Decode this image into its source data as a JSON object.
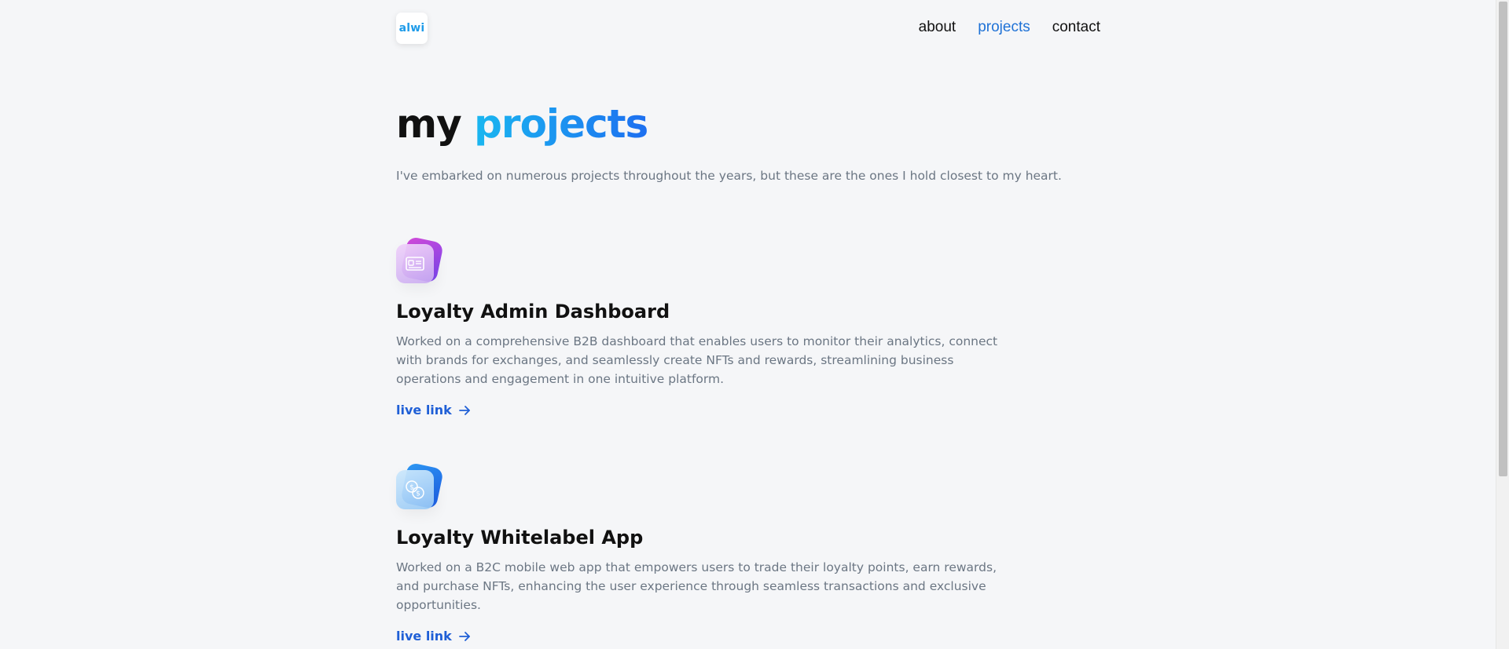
{
  "header": {
    "logo_text": "alwi",
    "nav": [
      {
        "label": "about",
        "active": false
      },
      {
        "label": "projects",
        "active": true
      },
      {
        "label": "contact",
        "active": false
      }
    ]
  },
  "hero": {
    "title_prefix": "my",
    "title_accent": "projects",
    "intro": "I've embarked on numerous projects throughout the years, but these are the ones I hold closest to my heart."
  },
  "projects": [
    {
      "icon": "dashboard-card-icon",
      "title": "Loyalty Admin Dashboard",
      "description": "Worked on a comprehensive B2B dashboard that enables users to monitor their analytics, connect with brands for exchanges, and seamlessly create NFTs and rewards, streamlining business operations and engagement in one intuitive platform.",
      "link_label": "live link"
    },
    {
      "icon": "currency-exchange-icon",
      "title": "Loyalty Whitelabel App",
      "description": "Worked on a B2C mobile web app that empowers users to trade their loyalty points, earn rewards, and purchase NFTs, enhancing the user experience through seamless transactions and exclusive opportunities.",
      "link_label": "live link"
    }
  ],
  "colors": {
    "accent_start": "#1ab7f0",
    "accent_end": "#1d6ff0",
    "link": "#1f5fd6",
    "nav_active": "#1f72d6",
    "muted_text": "#6b7683",
    "background": "#f5f6f8"
  }
}
